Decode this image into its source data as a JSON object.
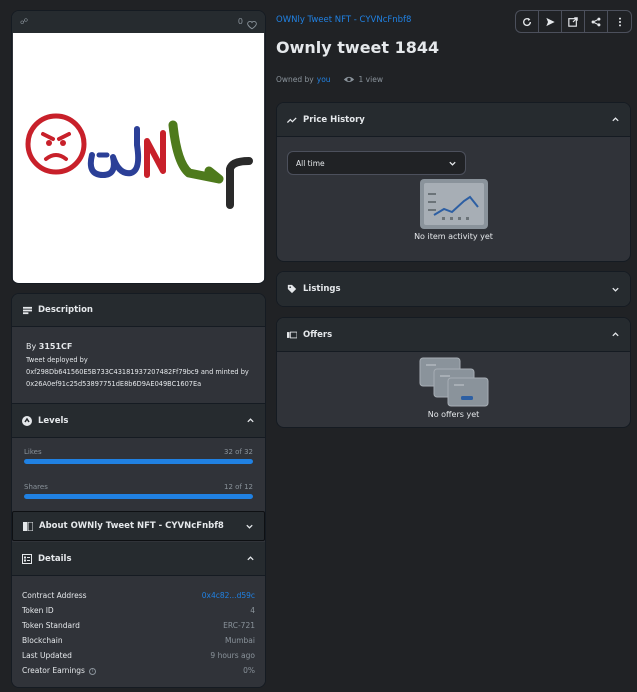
{
  "asset": {
    "favorites": "0",
    "collection_link": "OWNly Tweet NFT - CYVNcFnbf8",
    "title": "Ownly tweet 1844",
    "owned_by_prefix": "Owned by",
    "owner": "you",
    "views": "1 view"
  },
  "description": {
    "header": "Description",
    "by_prefix": "By",
    "creator": "3151CF",
    "text_line1": "Tweet deployed by",
    "text_line2": "0xf298Db641560E5B733C43181937207482Ff79bc9 and minted by",
    "text_line3": "0x26A0ef91c25d53897751dE8b6D9AE049BC1607Ea"
  },
  "levels": {
    "header": "Levels",
    "items": [
      {
        "label": "Likes",
        "value": "32 of 32",
        "fraction": 1.0
      },
      {
        "label": "Shares",
        "value": "12 of 12",
        "fraction": 1.0
      }
    ]
  },
  "about": {
    "header": "About OWNly Tweet NFT - CYVNcFnbf8"
  },
  "details": {
    "header": "Details",
    "rows": [
      {
        "label": "Contract Address",
        "value": "0x4c82...d59c"
      },
      {
        "label": "Token ID",
        "value": "4"
      },
      {
        "label": "Token Standard",
        "value": "ERC-721"
      },
      {
        "label": "Blockchain",
        "value": "Mumbai"
      },
      {
        "label": "Last Updated",
        "value": "9 hours ago"
      },
      {
        "label": "Creator Earnings",
        "value": "0%"
      }
    ]
  },
  "price_history": {
    "header": "Price History",
    "select_value": "All time",
    "empty_text": "No item activity yet"
  },
  "listings": {
    "header": "Listings"
  },
  "offers": {
    "header": "Offers",
    "empty_text": "No offers yet"
  },
  "colors": {
    "accent": "#2081e2",
    "bg": "#202225",
    "card": "#303339"
  }
}
